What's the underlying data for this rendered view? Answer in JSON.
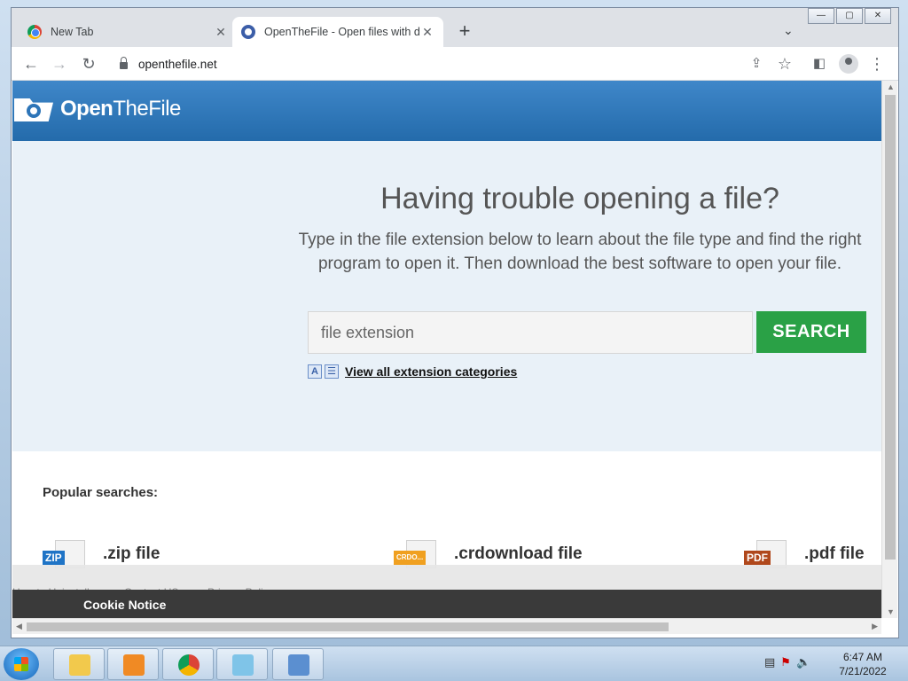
{
  "browser": {
    "tabs": [
      {
        "title": "New Tab",
        "active": false
      },
      {
        "title": "OpenTheFile - Open files with dif",
        "active": true
      }
    ],
    "url": "openthefile.net"
  },
  "site": {
    "logo_open": "Open",
    "logo_rest": "TheFile",
    "heading": "Having trouble opening a file?",
    "subheading": "Type in the file extension below to learn about the file type and find the right program to open it. Then download the best software to open your file.",
    "search_placeholder": "file extension",
    "search_button": "SEARCH",
    "view_all_link": "View all extension categories",
    "popular_title": "Popular searches:",
    "popular": [
      {
        "tag": "ZIP",
        "label": ".zip file",
        "color": "#1f74c6"
      },
      {
        "tag": "CRDO...",
        "label": ".crdownload file",
        "color": "#f0a020"
      },
      {
        "tag": "PDF",
        "label": ".pdf file",
        "color": "#b0481c"
      }
    ],
    "footer_links": [
      "How to Uninstall",
      "Contact US",
      "Privacy Policy"
    ],
    "cookie_title": "Cookie Notice"
  },
  "taskbar": {
    "time": "6:47 AM",
    "date": "7/21/2022"
  }
}
